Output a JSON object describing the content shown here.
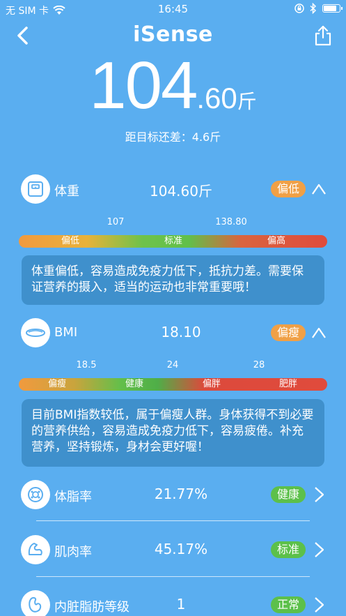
{
  "status_bar": {
    "carrier": "无 SIM 卡",
    "time": "16:45"
  },
  "nav": {
    "title": "iSense"
  },
  "weight": {
    "int": "104",
    "dec": ".60",
    "unit": "斤"
  },
  "target_diff": "距目标还差：4.6斤",
  "metrics": [
    {
      "label": "体重",
      "value": "104.60斤",
      "badge": "偏低",
      "badge_color": "#f0a046",
      "icon": "scale-icon"
    },
    {
      "label": "BMI",
      "value": "18.10",
      "badge": "偏瘦",
      "badge_color": "#f0a046",
      "icon": "bmi-icon"
    },
    {
      "label": "体脂率",
      "value": "21.77%",
      "badge": "健康",
      "badge_color": "#5cc04a",
      "icon": "body-fat-icon"
    },
    {
      "label": "肌肉率",
      "value": "45.17%",
      "badge": "标准",
      "badge_color": "#5cc04a",
      "icon": "muscle-icon"
    },
    {
      "label": "内脏脂肪等级",
      "value": "1",
      "badge": "正常",
      "badge_color": "#5cc04a",
      "icon": "visceral-fat-icon"
    }
  ],
  "weight_scale": {
    "ticks": [
      "107",
      "138.80"
    ],
    "segments": [
      "偏低",
      "标准",
      "偏高"
    ]
  },
  "weight_info": "体重偏低，容易造成免疫力低下，抵抗力差。需要保证营养的摄入，适当的运动也非常重要哦！",
  "bmi_scale": {
    "ticks": [
      "18.5",
      "24",
      "28"
    ],
    "segments": [
      "偏瘦",
      "健康",
      "偏胖",
      "肥胖"
    ]
  },
  "bmi_info": "目前BMI指数较低，属于偏瘦人群。身体获得不到必要的营养供给，容易造成免疫力低下，容易疲倦。补充营养，坚持锻炼，身材会更好喔！",
  "colors": {
    "background": "#5aaef0",
    "info_box": "#3f90cc",
    "orange": "#f0a046",
    "green": "#5cc04a"
  }
}
